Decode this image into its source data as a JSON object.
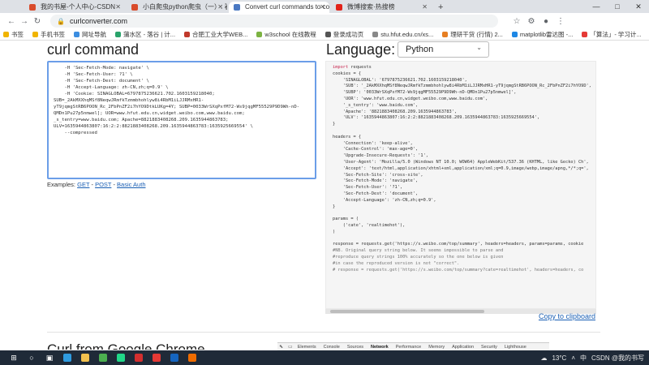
{
  "browser": {
    "tabs": [
      {
        "title": "我的书屋-个人中心-CSDN",
        "color": "#d94b2b",
        "active": false
      },
      {
        "title": "小白爬虫python爬虫（一）: 看完即可学会",
        "color": "#d94b2b",
        "active": false
      },
      {
        "title": "Convert curl commands to code",
        "color": "#4a78c2",
        "active": true
      },
      {
        "title": "微博搜索·热搜榜",
        "color": "#e2231a",
        "active": false
      }
    ],
    "new_tab": "+",
    "url": "curlconverter.com",
    "bookmarks": [
      {
        "label": "书签",
        "color": "#f0b400"
      },
      {
        "label": "手机书签",
        "color": "#f0b400"
      },
      {
        "label": "网址导航",
        "color": "#3b8de0"
      },
      {
        "label": "蒲水区 - 落谷 | 计...",
        "color": "#2aa36b"
      },
      {
        "label": "合肥工业大学WEB...",
        "color": "#c0392b"
      },
      {
        "label": "w3school 在线教程",
        "color": "#7cb342"
      },
      {
        "label": "登录成功页",
        "color": "#555555"
      },
      {
        "label": "stu.hfut.edu.cn/xs...",
        "color": "#888888"
      },
      {
        "label": "理研干货 (行情) 2...",
        "color": "#e67e22"
      },
      {
        "label": "matplotlib雷达图 -...",
        "color": "#1e88e5"
      },
      {
        "label": "「算法」- 学习计...",
        "color": "#e53935"
      }
    ]
  },
  "page": {
    "curl_heading": "curl command",
    "curl_text": "    -H 'Sec-Fetch-Mode: navigate' \\\n    -H 'Sec-Fetch-User: ?1' \\\n    -H 'Sec-Fetch-Dest: document' \\\n    -H 'Accept-Language: zh-CN,zh;q=0.9' \\\n    -H 'Cookie: SINAGLOBAL=6797875236621.702.1603159218040;\nSUB=_2AkMXXhqMSf8NeqwJRmfkTzmmbhohlyw8i4RbM1iLJJRMxHR1-\nyT9jqmgStRB6POON_Rc_2FbPnZF2i7hYO9DtkLUKg=4Y; SUBP=0033WrSXqPxfM72-Ws9jqgMF55529P9D9Wh-nD-\nQMDn1Pu27p5nmwel]; UOR=www.hfut.edu.cn,widget.weibo.com,www.baidu.com;\n_s_tentry=www.baidu.com; Apache=8821883408268.209.1635944863783;\nULV=1635944863807:16:2:2:8821883408268.209.1635944863783:1635925669554' \\\n    --compressed",
    "examples_label": "Examples:",
    "example_links": [
      "GET",
      "POST",
      "Basic Auth"
    ],
    "example_separator": " - ",
    "language_heading": "Language:",
    "language_selected": "Python",
    "code_keyword": "import",
    "code_module": "requests",
    "code_text": "\ncookies = {\n    'SINAGLOBAL': '6797875236621.702.1603159218040',\n    'SUB': '_2AkMXXhqMSf8NeqwJRmfkTzmmbhohlyw8i4RbM1iLJJRMxHR1-yT9jqmgStRB6POON_Rc_2FbPnZF2i7hYO9D',\n    'SUBP': '0033WrSXqPxfM72-Ws9jqgMF55529P9D9Wh-nD-QMDn1Pu27p5nmwel]',\n    'UOR': 'www.hfut.edu.cn,widget.weibo.com,www.baidu.com',\n    '_s_tentry': 'www.baidu.com',\n    'Apache': '8821883408268.209.1635944863783',\n    'ULV': '1635944863807:16:2:2:8821883408268.209.1635944863783:1635925669554',\n}\n\nheaders = {\n    'Connection': 'keep-alive',\n    'Cache-Control': 'max-age=0',\n    'Upgrade-Insecure-Requests': '1',\n    'User-Agent': 'Mozilla/5.0 (Windows NT 10.0; WOW64) AppleWebKit/537.36 (KHTML, like Gecko) Ch',\n    'Accept': 'text/html,application/xhtml+xml,application/xml;q=0.9,image/webp,image/apng,*/*;q=',\n    'Sec-Fetch-Site': 'cross-site',\n    'Sec-Fetch-Mode': 'navigate',\n    'Sec-Fetch-User': '?1',\n    'Sec-Fetch-Dest': 'document',\n    'Accept-Language': 'zh-CN,zh;q=0.9',\n}\n\nparams = (\n    ('cate', 'realtimehot'),\n)\n\nresponse = requests.get('https://s.weibo.com/top/summary', headers=headers, params=params, cookie\n",
    "code_comment": "#NB. Original query string below. It seems impossible to parse and\n#reproduce query strings 100% accurately so the one below is given\n#in case the reproduced version is not \"correct\".\n# response = requests.get('https://s.weibo.com/top/summary?cate=realtimehot', headers=headers, co",
    "copy_label": "Copy to clipboard",
    "chrome_heading": "Curl from Google Chrome"
  },
  "devtools": {
    "tabs": [
      "Elements",
      "Console",
      "Sources",
      "Network",
      "Performance",
      "Memory",
      "Application",
      "Security",
      "Lighthouse"
    ],
    "active": "Network"
  },
  "taskbar": {
    "apps": [
      {
        "name": "start",
        "color": "#ffffff"
      },
      {
        "name": "search",
        "color": "#ffffff"
      },
      {
        "name": "task-view",
        "color": "#ffffff"
      },
      {
        "name": "edge",
        "color": "#2f9be0"
      },
      {
        "name": "explorer",
        "color": "#f2c14e"
      },
      {
        "name": "chrome",
        "color": "#4caf50"
      },
      {
        "name": "pycharm",
        "color": "#21d789"
      },
      {
        "name": "wps",
        "color": "#d32f2f"
      },
      {
        "name": "app-red",
        "color": "#e53935"
      },
      {
        "name": "app-blue",
        "color": "#1565c0"
      },
      {
        "name": "app-orange",
        "color": "#ef6c00"
      }
    ],
    "temperature": "13°C",
    "weather_icon": "cloud-icon",
    "ime": "中",
    "tray_text": "CSDN @我的书写"
  }
}
